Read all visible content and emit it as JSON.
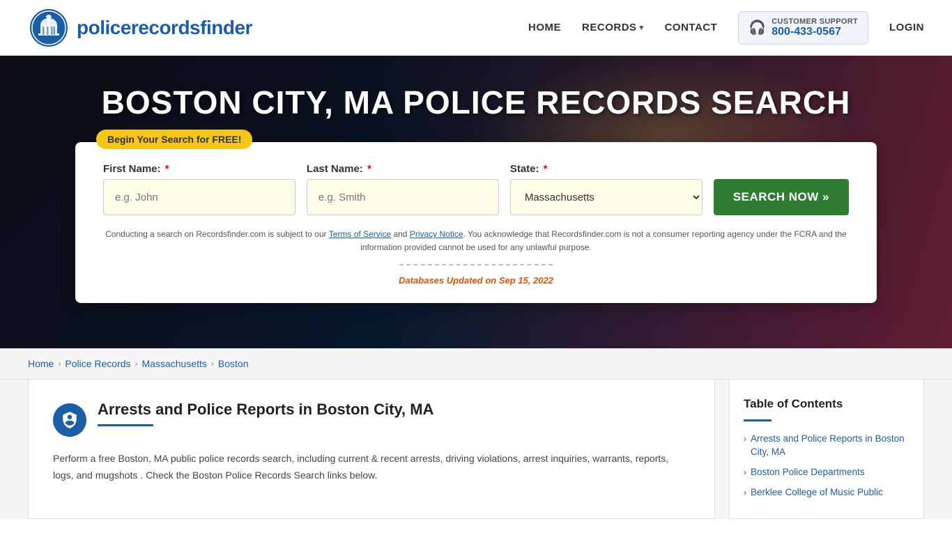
{
  "header": {
    "logo_text_regular": "policerecords",
    "logo_text_bold": "finder",
    "nav": {
      "home": "HOME",
      "records": "RECORDS",
      "contact": "CONTACT",
      "login": "LOGIN"
    },
    "support": {
      "label": "CUSTOMER SUPPORT",
      "number": "800-433-0567"
    }
  },
  "hero": {
    "title": "BOSTON CITY, MA POLICE RECORDS SEARCH",
    "badge": "Begin Your Search for FREE!"
  },
  "search_form": {
    "first_name_label": "First Name:",
    "last_name_label": "Last Name:",
    "state_label": "State:",
    "first_name_placeholder": "e.g. John",
    "last_name_placeholder": "e.g. Smith",
    "state_value": "Massachusetts",
    "search_button": "SEARCH NOW »",
    "disclaimer": "Conducting a search on Recordsfinder.com is subject to our Terms of Service and Privacy Notice. You acknowledge that Recordsfinder.com is not a consumer reporting agency under the FCRA and the information provided cannot be used for any unlawful purpose.",
    "db_updated_prefix": "Databases Updated on",
    "db_updated_date": "Sep 15, 2022"
  },
  "breadcrumb": {
    "items": [
      "Home",
      "Police Records",
      "Massachusetts",
      "Boston"
    ]
  },
  "article": {
    "title": "Arrests and Police Reports in Boston City, MA",
    "body": "Perform a free Boston, MA public police records search, including current & recent arrests, driving violations, arrest inquiries, warrants, reports, logs, and mugshots . Check the Boston Police Records Search links below."
  },
  "toc": {
    "title": "Table of Contents",
    "items": [
      "Arrests and Police Reports in Boston City, MA",
      "Boston Police Departments",
      "Berklee College of Music Public"
    ]
  }
}
